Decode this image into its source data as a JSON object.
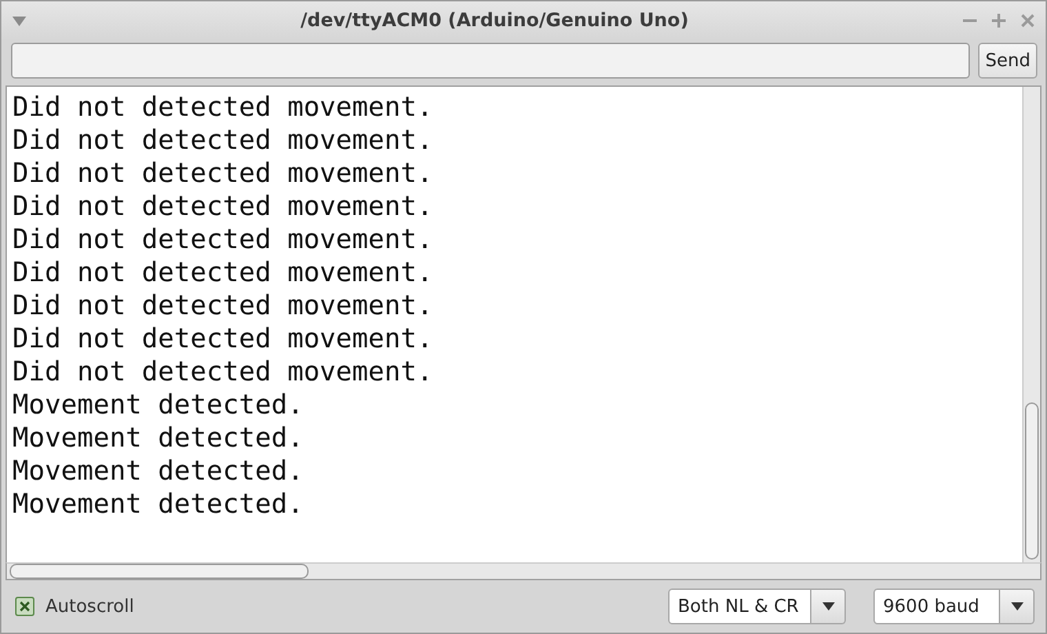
{
  "window": {
    "title": "/dev/ttyACM0 (Arduino/Genuino Uno)"
  },
  "input": {
    "send_button": "Send"
  },
  "output_lines": [
    "Did not detected movement.",
    "Did not detected movement.",
    "Did not detected movement.",
    "Did not detected movement.",
    "Did not detected movement.",
    "Did not detected movement.",
    "Did not detected movement.",
    "Did not detected movement.",
    "Did not detected movement.",
    "Movement detected.",
    "Movement detected.",
    "Movement detected.",
    "Movement detected."
  ],
  "autoscroll": {
    "label": "Autoscroll",
    "checked": true
  },
  "line_ending": {
    "value": "Both NL & CR"
  },
  "baud": {
    "value": "9600 baud"
  }
}
